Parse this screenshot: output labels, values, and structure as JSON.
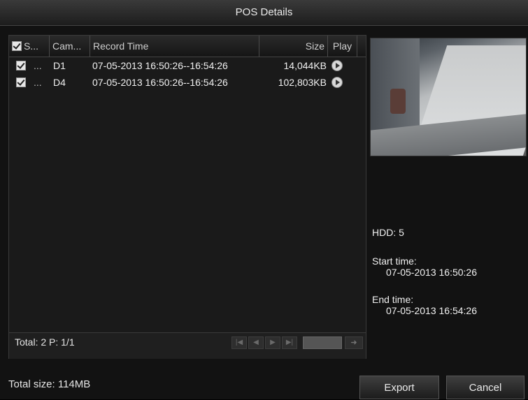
{
  "window": {
    "title": "POS Details"
  },
  "table": {
    "headers": {
      "select": "S...",
      "camera": "Cam...",
      "record_time": "Record Time",
      "size": "Size",
      "play": "Play"
    },
    "rows": [
      {
        "camera_trunc": "...",
        "camera": "D1",
        "record_time": "07-05-2013 16:50:26--16:54:26",
        "size": "14,044KB"
      },
      {
        "camera_trunc": "...",
        "camera": "D4",
        "record_time": "07-05-2013 16:50:26--16:54:26",
        "size": "102,803KB"
      }
    ]
  },
  "pagination": {
    "summary": "Total: 2  P: 1/1",
    "page_input_value": ""
  },
  "details": {
    "hdd": "HDD: 5",
    "start_label": "Start time:",
    "start_value": "07-05-2013 16:50:26",
    "end_label": "End time:",
    "end_value": "07-05-2013 16:54:26"
  },
  "footer": {
    "total_size": "Total size: 114MB",
    "export_label": "Export",
    "cancel_label": "Cancel"
  },
  "icons": {
    "checkbox": "checkbox-checked-icon",
    "play": "play-circle-icon",
    "first": "first-page-icon",
    "prev": "prev-page-icon",
    "next": "next-page-icon",
    "last": "last-page-icon",
    "go": "go-arrow-icon"
  }
}
